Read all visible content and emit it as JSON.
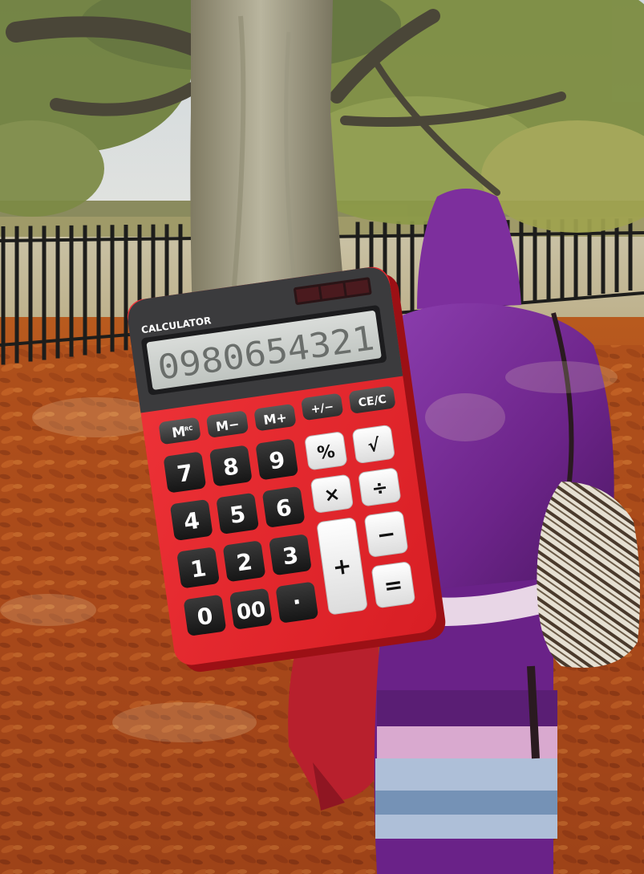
{
  "calculator": {
    "brand": "CALCULATOR",
    "display": "0980654321",
    "memory_keys": {
      "mrc_main": "M",
      "mrc_sub": "RC",
      "m_minus": "M−",
      "m_plus": "M+"
    },
    "keys": {
      "plus_minus": "+/−",
      "clear": "CE/C",
      "percent": "%",
      "sqrt": "√",
      "seven": "7",
      "eight": "8",
      "nine": "9",
      "four": "4",
      "five": "5",
      "six": "6",
      "one": "1",
      "two": "2",
      "three": "3",
      "zero": "0",
      "double_zero": "00",
      "decimal": "·",
      "multiply": "×",
      "divide": "÷",
      "minus": "−",
      "plus": "+",
      "equals": "="
    }
  },
  "colors": {
    "body_red": "#e8262a",
    "body_dark": "#3a3a3c",
    "lcd": "#cfd3d0",
    "key_dark": "#2a2a2a",
    "key_light": "#f2f2f2",
    "leaves": "#b4541c",
    "dress_purple": "#7b2f9a"
  }
}
